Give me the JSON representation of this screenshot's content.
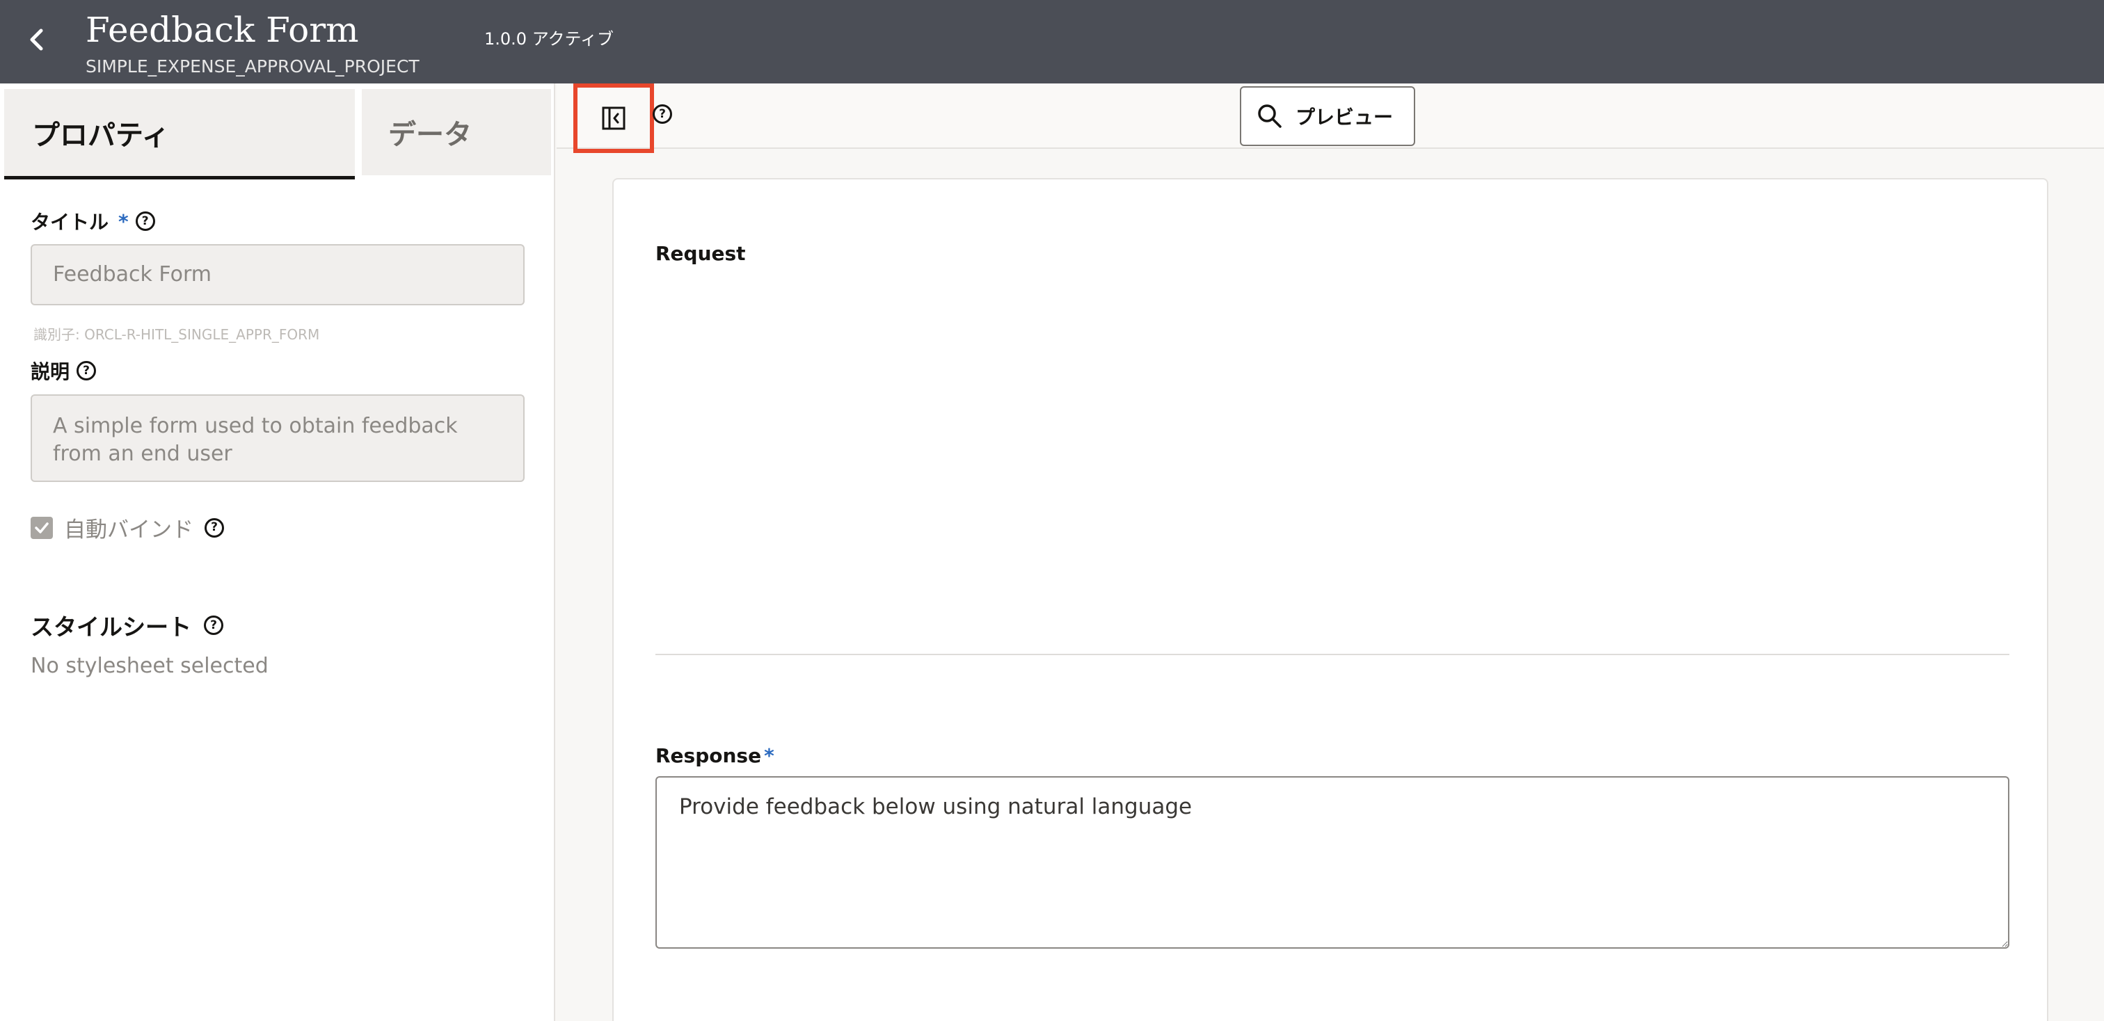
{
  "header": {
    "title": "Feedback Form",
    "project": "SIMPLE_EXPENSE_APPROVAL_PROJECT",
    "version": "1.0.0 アクティブ",
    "background": "#4b4e56"
  },
  "left_panel": {
    "tabs": [
      {
        "label": "プロパティ",
        "active": true
      },
      {
        "label": "データ",
        "active": false
      }
    ],
    "title_field": {
      "label": "タイトル",
      "required_mark": "*",
      "value": "Feedback Form",
      "identifier": "識別子: ORCL-R-HITL_SINGLE_APPR_FORM"
    },
    "description_field": {
      "label": "説明",
      "value": "A simple form used to obtain feedback from an end user"
    },
    "auto_bind": {
      "label": "自動バインド",
      "checked": true
    },
    "stylesheet": {
      "title": "スタイルシート",
      "empty_text": "No stylesheet selected"
    }
  },
  "toolbar": {
    "collapse_icon": "panel-collapse-icon",
    "highlight_color": "#e8472c",
    "preview_label": "プレビュー"
  },
  "canvas": {
    "request_label": "Request",
    "response_label": "Response",
    "response_required_mark": "*",
    "response_placeholder": "Provide feedback below using natural language"
  },
  "icons": {
    "help": "?"
  }
}
